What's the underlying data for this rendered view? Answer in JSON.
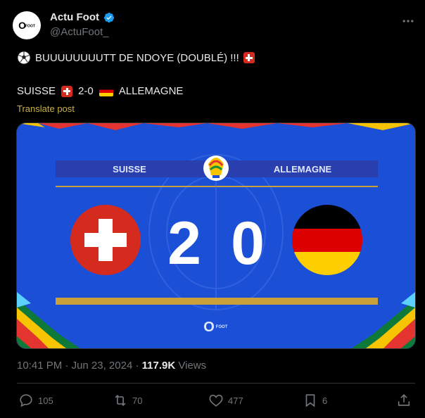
{
  "author": {
    "name": "Actu Foot",
    "handle": "@ActuFoot_",
    "avatar_text": "O",
    "avatar_sub": "FOOT"
  },
  "post": {
    "line1": "BUUUUUUUUTT DE NDOYE (DOUBLÉ) !!!",
    "line2_home": "SUISSE",
    "line2_score": "2-0",
    "line2_away": "ALLEMAGNE",
    "translate": "Translate post"
  },
  "media": {
    "home_team": "SUISSE",
    "away_team": "ALLEMAGNE",
    "home_score": "2",
    "away_score": "0",
    "watermark": "FOOT",
    "colors": {
      "background": "#1b4fd6",
      "bar": "#2a3fae",
      "gold": "#c8a13a"
    }
  },
  "meta": {
    "time": "10:41 PM",
    "date": "Jun 23, 2024",
    "views": "117.9K",
    "views_label": "Views",
    "separator": "·"
  },
  "actions": {
    "replies": "105",
    "reposts": "70",
    "likes": "477",
    "bookmarks": "6"
  }
}
